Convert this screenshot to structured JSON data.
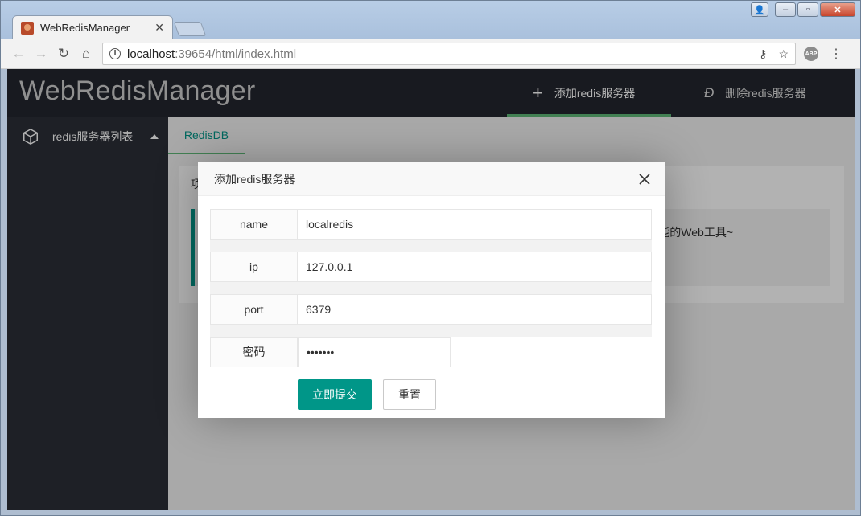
{
  "browser": {
    "tab_title": "WebRedisManager",
    "url_host": "localhost",
    "url_rest": ":39654/html/index.html"
  },
  "app": {
    "logo": "WebRedisManager",
    "nav_add": "添加redis服务器",
    "nav_delete": "删除redis服务器",
    "sidebar_title": "redis服务器列表",
    "tab_label": "RedisDB",
    "card_title": "项",
    "quote_text": "能的Web工具~"
  },
  "modal": {
    "title": "添加redis服务器",
    "fields": {
      "name_label": "name",
      "name_value": "localredis",
      "ip_label": "ip",
      "ip_value": "127.0.0.1",
      "port_label": "port",
      "port_value": "6379",
      "password_label": "密码",
      "password_value": "•••••••"
    },
    "submit_label": "立即提交",
    "reset_label": "重置"
  },
  "colors": {
    "header_bg": "#23262e",
    "sidebar_bg": "#2b2e37",
    "accent_green": "#009688",
    "nav_underline": "#5fb878"
  }
}
